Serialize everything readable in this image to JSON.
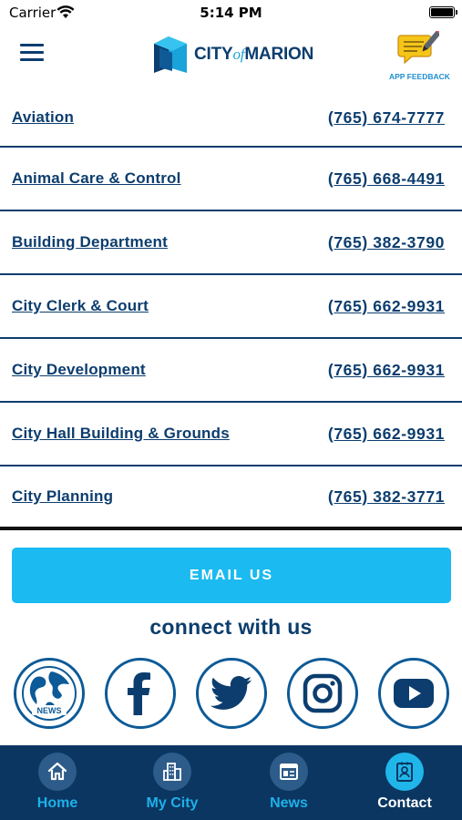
{
  "status_bar": {
    "carrier": "Carrier",
    "time": "5:14 PM"
  },
  "header": {
    "logo": {
      "prefix": "CITY",
      "of": "of",
      "suffix": "MARION"
    },
    "feedback_label": "APP FEEDBACK"
  },
  "directory": [
    {
      "name": "Aviation",
      "phone": "(765) 674-7777"
    },
    {
      "name": "Animal Care & Control",
      "phone": "(765) 668-4491"
    },
    {
      "name": "Building Department",
      "phone": "(765) 382-3790"
    },
    {
      "name": "City Clerk & Court",
      "phone": "(765) 662-9931"
    },
    {
      "name": "City Development",
      "phone": "(765) 662-9931"
    },
    {
      "name": "City Hall Building & Grounds",
      "phone": "(765) 662-9931"
    },
    {
      "name": "City Planning",
      "phone": "(765) 382-3771"
    }
  ],
  "email_button": "EMAIL US",
  "connect_title": "connect with us",
  "social": {
    "news_label": "NEWS",
    "icons": [
      "news-globe-icon",
      "facebook-icon",
      "twitter-icon",
      "instagram-icon",
      "youtube-icon"
    ]
  },
  "tabs": [
    {
      "label": "Home",
      "icon": "home-icon",
      "active": false
    },
    {
      "label": "My City",
      "icon": "city-buildings-icon",
      "active": false
    },
    {
      "label": "News",
      "icon": "newspaper-icon",
      "active": false
    },
    {
      "label": "Contact",
      "icon": "contact-card-icon",
      "active": true
    }
  ],
  "colors": {
    "navy": "#0c3d6e",
    "accent_cyan": "#1bbaf0",
    "tab_bar": "#0a3661",
    "feedback_yellow": "#f5c518"
  }
}
